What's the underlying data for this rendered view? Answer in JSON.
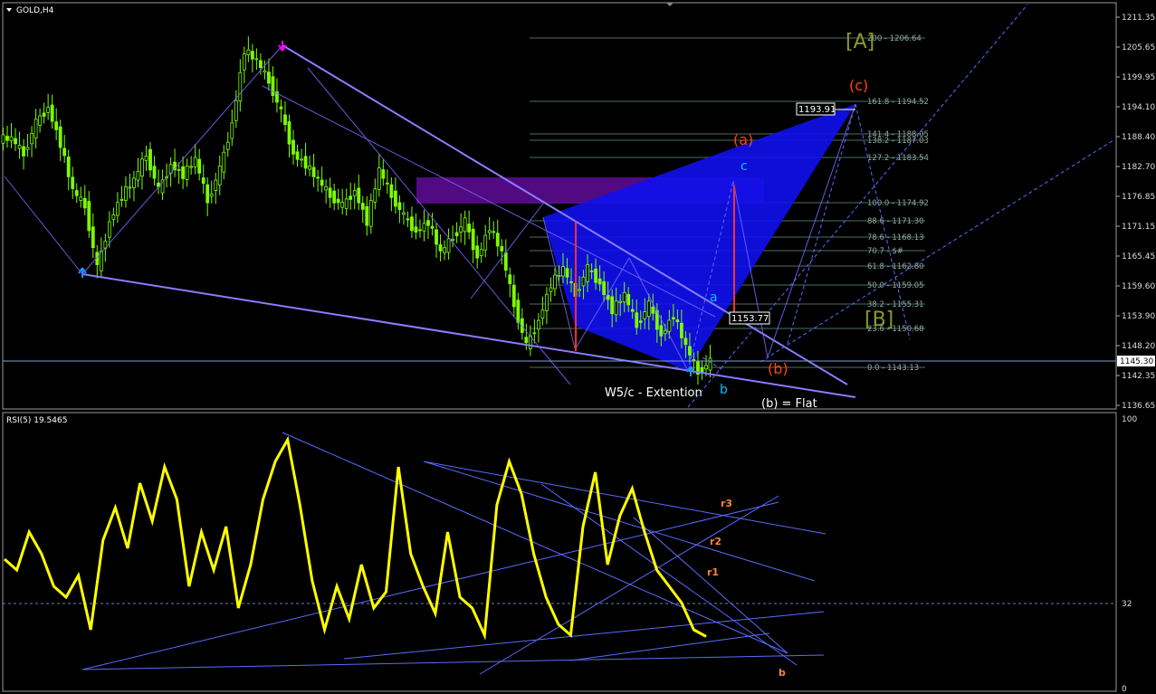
{
  "window": {
    "symbol": "GOLD,H4",
    "rsi_title": "RSI(5) 19.5465"
  },
  "price_axis": {
    "ticks": [
      "1211.35",
      "1205.65",
      "1199.95",
      "1194.10",
      "1188.40",
      "1182.70",
      "1176.85",
      "1171.15",
      "1165.45",
      "1159.60",
      "1153.90",
      "1148.20",
      "1142.35",
      "1136.65"
    ],
    "current": "1145.30"
  },
  "rsi_axis": {
    "ticks": [
      "100",
      "32",
      "0"
    ]
  },
  "fib_levels": [
    {
      "label": "200 - 1206.64"
    },
    {
      "label": "161.8 - 1194.52"
    },
    {
      "label": "141.4 - 1188.05"
    },
    {
      "label": "138.2 - 1187.03"
    },
    {
      "label": "127.2 - 1183.54"
    },
    {
      "label": "100.0 - 1174.92"
    },
    {
      "label": "88.6 - 1171.30"
    },
    {
      "label": "78.6 - 1168.13"
    },
    {
      "label": "70.7 - $#"
    },
    {
      "label": "61.8 - 1162.80"
    },
    {
      "label": "50.0 - 1159.05"
    },
    {
      "label": "38.2 - 1155.31"
    },
    {
      "label": "23.6 - 1150.68"
    },
    {
      "label": "0.0 - 1143.13"
    }
  ],
  "annotations": {
    "A": "[A]",
    "B": "[B]",
    "c_paren": "(c)",
    "a_paren": "(a)",
    "b_paren": "(b)",
    "c_small": "c",
    "a_small": "a",
    "b_small": "b",
    "w5": "W5/c - Extention",
    "flat": "(b) = Flat",
    "price_box_1": "1193.91",
    "price_box_2": "1153.77"
  },
  "rsi_labels": {
    "r3": "r3",
    "r2": "r2",
    "r1": "r1",
    "b": "b"
  },
  "colors": {
    "candle": "#7CFC00",
    "trend": "#8a7cff",
    "pattern": "#1010ee",
    "zone": "#5a0b8f",
    "rsi": "#ffff00",
    "red_label": "#ff4500",
    "cyan_label": "#00bfff",
    "olive_label": "#9acd32"
  },
  "chart_data": {
    "type": "line",
    "title": "GOLD,H4",
    "ylim": [
      1136.65,
      1211.35
    ],
    "series": [
      {
        "name": "GOLD,H4",
        "values": [
          1188,
          1185,
          1191,
          1194,
          1187,
          1178,
          1175,
          1163,
          1172,
          1177,
          1180,
          1185,
          1178,
          1183,
          1181,
          1184,
          1176,
          1182,
          1191,
          1205,
          1203,
          1199,
          1193,
          1185,
          1183,
          1180,
          1177,
          1175,
          1178,
          1172,
          1182,
          1177,
          1173,
          1170,
          1172,
          1166,
          1169,
          1172,
          1165,
          1171,
          1166,
          1156,
          1148,
          1153,
          1160,
          1163,
          1158,
          1163,
          1160,
          1155,
          1158,
          1152,
          1156,
          1150,
          1154,
          1148,
          1143,
          1145
        ]
      }
    ]
  },
  "rsi_data": {
    "type": "line",
    "ylim": [
      0,
      100
    ],
    "values": [
      48,
      44,
      58,
      50,
      38,
      34,
      42,
      22,
      55,
      67,
      52,
      76,
      62,
      82,
      70,
      38,
      58,
      44,
      60,
      30,
      46,
      70,
      84,
      92,
      68,
      40,
      22,
      38,
      26,
      46,
      30,
      36,
      82,
      50,
      38,
      28,
      58,
      34,
      30,
      20,
      68,
      84,
      72,
      50,
      34,
      24,
      20,
      60,
      80,
      46,
      64,
      74,
      58,
      44,
      38,
      32,
      22,
      19.5465
    ]
  }
}
